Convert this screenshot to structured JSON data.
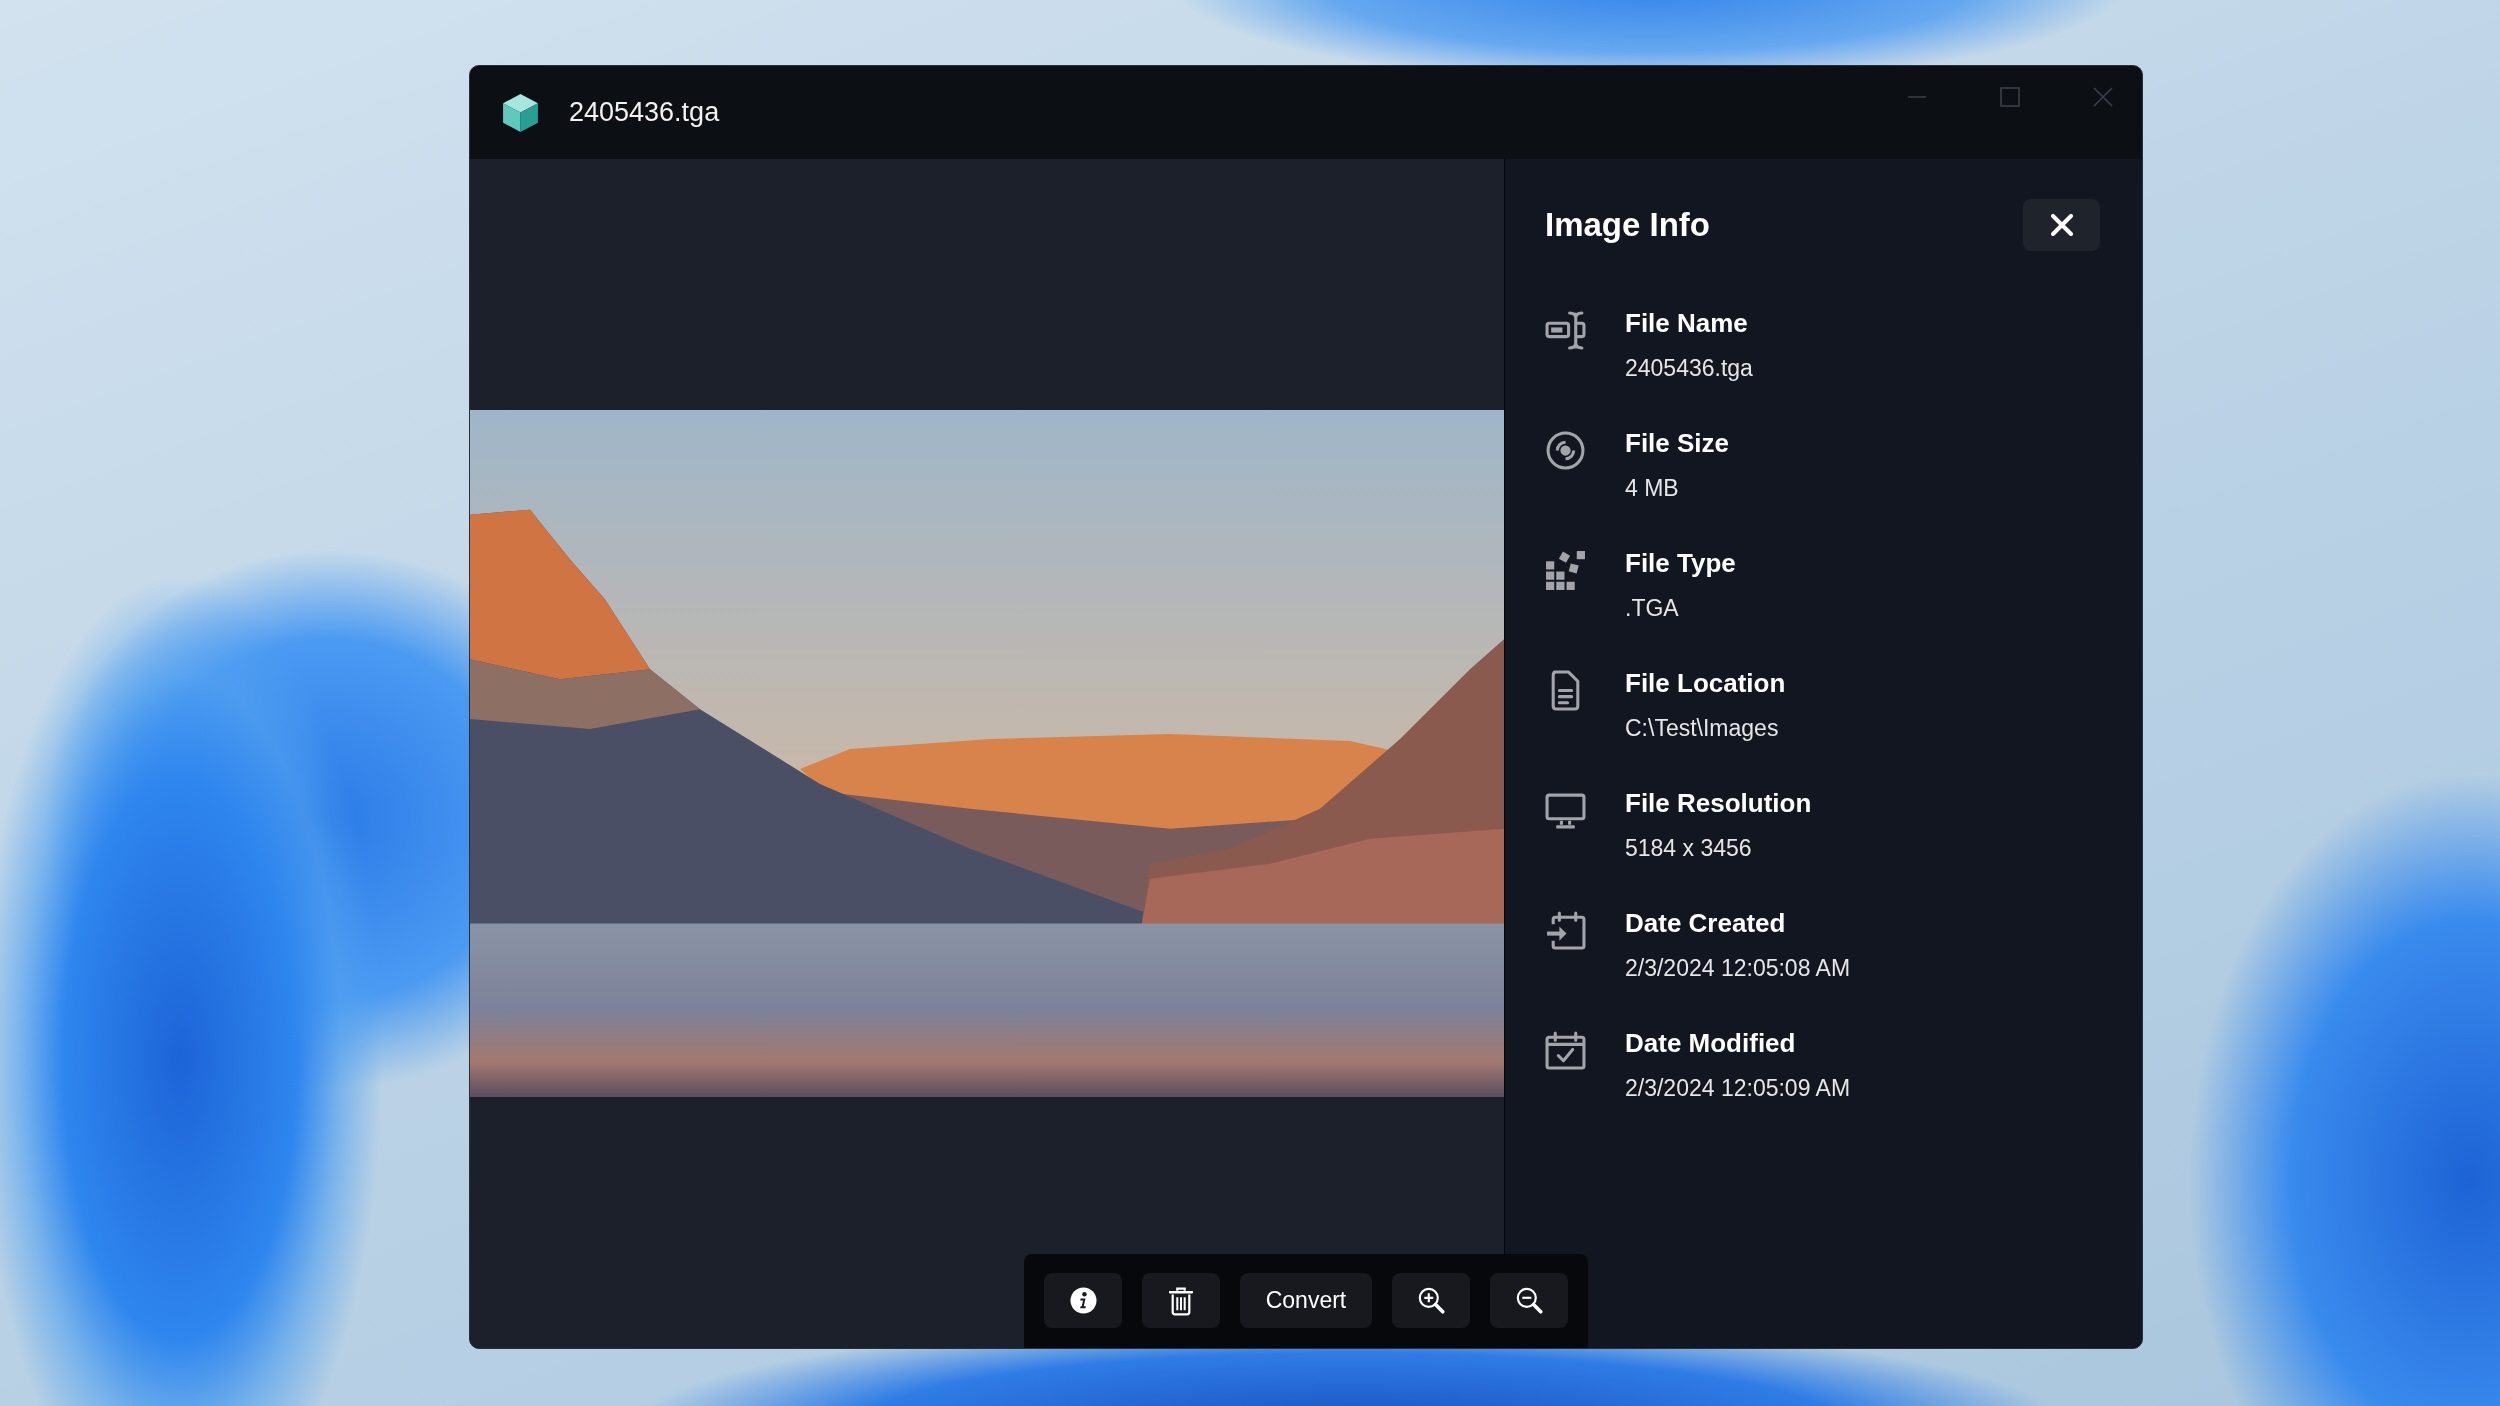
{
  "window": {
    "title": "2405436.tga"
  },
  "info_panel": {
    "title": "Image Info",
    "items": [
      {
        "label": "File Name",
        "value": "2405436.tga"
      },
      {
        "label": "File Size",
        "value": "4 MB"
      },
      {
        "label": "File Type",
        "value": ".TGA"
      },
      {
        "label": "File Location",
        "value": "C:\\Test\\Images"
      },
      {
        "label": "File Resolution",
        "value": "5184 x 3456"
      },
      {
        "label": "Date Created",
        "value": "2/3/2024 12:05:08 AM"
      },
      {
        "label": "Date Modified",
        "value": "2/3/2024 12:05:09 AM"
      }
    ]
  },
  "toolbar": {
    "convert_button": "Convert"
  }
}
